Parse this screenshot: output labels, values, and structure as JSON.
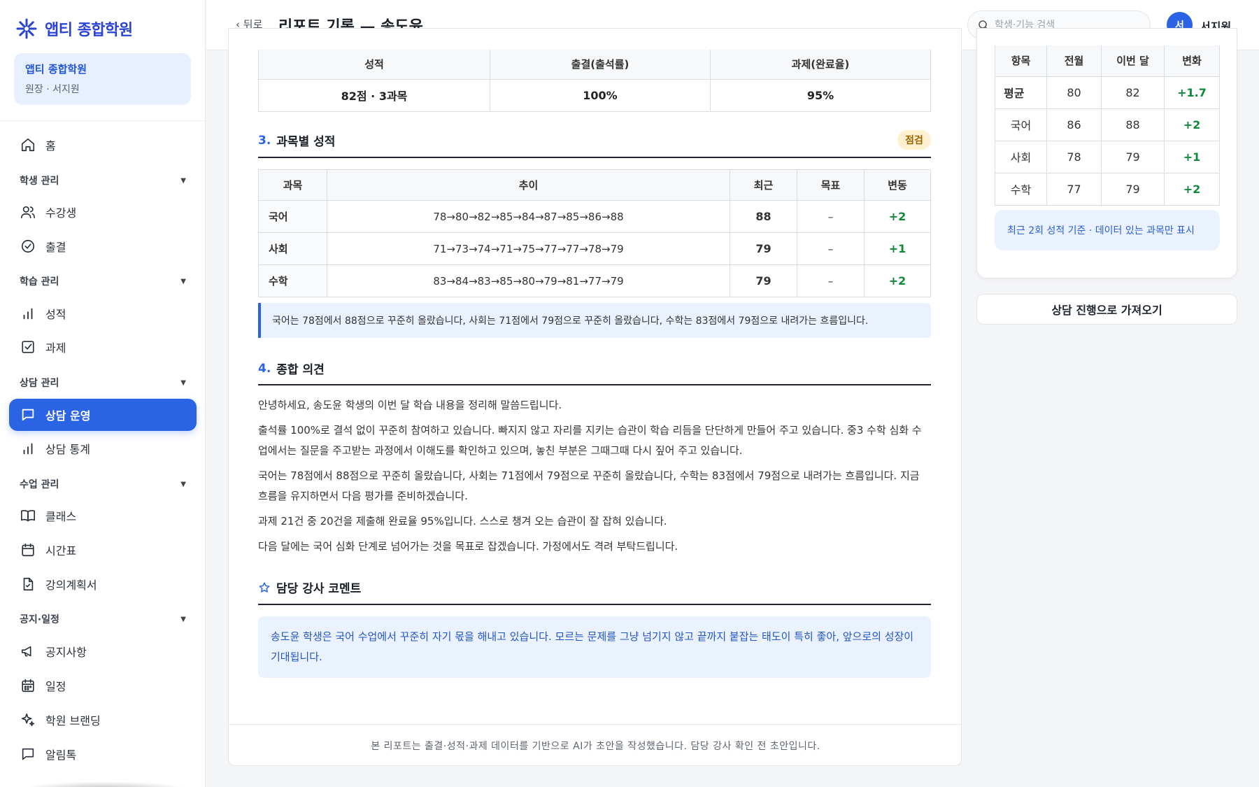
{
  "brand": {
    "name": "앱티 종합학원"
  },
  "org": {
    "name": "앱티 종합학원",
    "role": "원장 · 서지원"
  },
  "nav": {
    "home": "홈",
    "groups": {
      "student": "학생 관리",
      "learning": "학습 관리",
      "counsel": "상담 관리",
      "class": "수업 관리",
      "notice": "공지·일정"
    },
    "items": {
      "students": "수강생",
      "attendance": "출결",
      "grades": "성적",
      "homework": "과제",
      "counsel_ops": "상담 운영",
      "counsel_stats": "상담 통계",
      "classes": "클래스",
      "timetable": "시간표",
      "syllabus": "강의계획서",
      "notices": "공지사항",
      "schedule": "일정",
      "branding": "학원 브랜딩",
      "alimtalk": "알림톡"
    },
    "active": "counsel_ops"
  },
  "topbar": {
    "back": "‹ 뒤로",
    "title": "리포트 기록 — 송도윤",
    "search_placeholder": "학생·기능 검색",
    "avatar": "서",
    "user": "서지원"
  },
  "summary": {
    "headers": [
      "성적",
      "출결(출석률)",
      "과제(완료율)"
    ],
    "values": [
      "82점 · 3과목",
      "100%",
      "95%"
    ]
  },
  "section3": {
    "num": "3.",
    "title": "과목별 성적",
    "badge": "점검",
    "headers": [
      "과목",
      "추이",
      "최근",
      "목표",
      "변동"
    ],
    "rows": [
      {
        "subject": "국어",
        "trend": "78→80→82→85→84→87→85→86→88",
        "recent": "88",
        "target": "–",
        "delta": "+2"
      },
      {
        "subject": "사회",
        "trend": "71→73→74→71→75→77→77→78→79",
        "recent": "79",
        "target": "–",
        "delta": "+1"
      },
      {
        "subject": "수학",
        "trend": "83→84→83→85→80→79→81→77→79",
        "recent": "79",
        "target": "–",
        "delta": "+2"
      }
    ],
    "note": "국어는 78점에서 88점으로 꾸준히 올랐습니다, 사회는 71점에서 79점으로 꾸준히 올랐습니다, 수학는 83점에서 79점으로 내려가는 흐름입니다."
  },
  "section4": {
    "num": "4.",
    "title": "종합 의견",
    "paragraphs": [
      "안녕하세요, 송도윤 학생의 이번 달 학습 내용을 정리해 말씀드립니다.",
      "출석률 100%로 결석 없이 꾸준히 참여하고 있습니다. 빠지지 않고 자리를 지키는 습관이 학습 리듬을 단단하게 만들어 주고 있습니다. 중3 수학 심화 수업에서는 질문을 주고받는 과정에서 이해도를 확인하고 있으며, 놓친 부분은 그때그때 다시 짚어 주고 있습니다.",
      "국어는 78점에서 88점으로 꾸준히 올랐습니다, 사회는 71점에서 79점으로 꾸준히 올랐습니다, 수학는 83점에서 79점으로 내려가는 흐름입니다. 지금 흐름을 유지하면서 다음 평가를 준비하겠습니다.",
      "과제 21건 중 20건을 제출해 완료율 95%입니다. 스스로 챙겨 오는 습관이 잘 잡혀 있습니다.",
      "다음 달에는 국어 심화 단계로 넘어가는 것을 목표로 잡겠습니다. 가정에서도 격려 부탁드립니다."
    ]
  },
  "teacher_comment": {
    "title": "담당 강사 코멘트",
    "text": "송도윤 학생은 국어 수업에서 꾸준히 자기 몫을 해내고 있습니다. 모르는 문제를 그냥 넘기지 않고 끝까지 붙잡는 태도이 특히 좋아, 앞으로의 성장이 기대됩니다."
  },
  "footer": "본 리포트는 출결·성적·과제 데이터를 기반으로 AI가 초안을 작성했습니다. 담당 강사 확인 전 초안입니다.",
  "compare": {
    "headers": [
      "항목",
      "전월",
      "이번 달",
      "변화"
    ],
    "rows": [
      {
        "label": "평균",
        "prev": "80",
        "curr": "82",
        "delta": "+1.7"
      },
      {
        "label": "국어",
        "prev": "86",
        "curr": "88",
        "delta": "+2"
      },
      {
        "label": "사회",
        "prev": "78",
        "curr": "79",
        "delta": "+1"
      },
      {
        "label": "수학",
        "prev": "77",
        "curr": "79",
        "delta": "+2"
      }
    ],
    "note": "최근 2회 성적 기준 · 데이터 있는 과목만 표시"
  },
  "import_button": "상담 진행으로 가져오기",
  "colors": {
    "accent": "#2a63e4",
    "positive": "#0f8a3c",
    "badge_bg": "#fdf1cf"
  }
}
